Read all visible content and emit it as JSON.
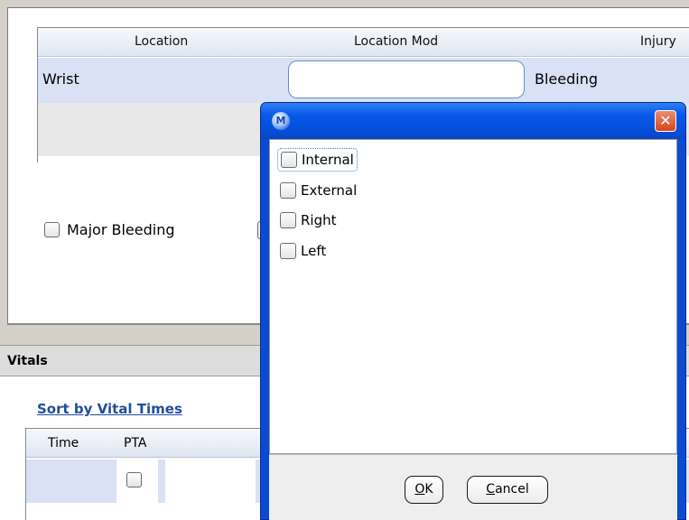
{
  "injury_grid": {
    "columns": [
      "Location",
      "Location Mod",
      "Injury"
    ],
    "row": {
      "location": "Wrist",
      "location_mod": "",
      "injury": "Bleeding"
    }
  },
  "major_bleeding_label": "Major Bleeding",
  "vitals": {
    "title": "Vitals",
    "sort_link": "Sort by Vital Times",
    "columns": [
      "Time",
      "PTA"
    ]
  },
  "dialog": {
    "icon": "app-logo-icon",
    "options": [
      {
        "label": "Internal",
        "checked": false
      },
      {
        "label": "External",
        "checked": false
      },
      {
        "label": "Right",
        "checked": false
      },
      {
        "label": "Left",
        "checked": false
      }
    ],
    "ok_label": "OK",
    "ok_mnemonic": "O",
    "cancel_label": "Cancel",
    "cancel_mnemonic": "C"
  }
}
